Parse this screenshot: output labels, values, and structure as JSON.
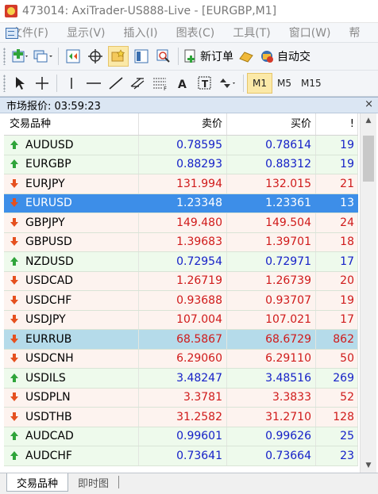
{
  "window": {
    "title": "473014: AxiTrader-US888-Live - [EURGBP,M1]"
  },
  "menu": [
    "文件(F)",
    "显示(V)",
    "插入(I)",
    "图表(C)",
    "工具(T)",
    "窗口(W)",
    "帮"
  ],
  "toolbar": {
    "new_order_label": "新订单",
    "autotrade_label": "自动交"
  },
  "timeframes": [
    "M1",
    "M5",
    "M15"
  ],
  "panel": {
    "title": "市场报价: 03:59:23",
    "close_glyph": "×"
  },
  "columns": {
    "symbol": "交易品种",
    "bid": "卖价",
    "ask": "买价",
    "spread": "!"
  },
  "rows": [
    {
      "symbol": "AUDUSD",
      "bid": "0.78595",
      "ask": "0.78614",
      "spread": "19",
      "dir": "up"
    },
    {
      "symbol": "EURGBP",
      "bid": "0.88293",
      "ask": "0.88312",
      "spread": "19",
      "dir": "up"
    },
    {
      "symbol": "EURJPY",
      "bid": "131.994",
      "ask": "132.015",
      "spread": "21",
      "dir": "down"
    },
    {
      "symbol": "EURUSD",
      "bid": "1.23348",
      "ask": "1.23361",
      "spread": "13",
      "dir": "down"
    },
    {
      "symbol": "GBPJPY",
      "bid": "149.480",
      "ask": "149.504",
      "spread": "24",
      "dir": "down"
    },
    {
      "symbol": "GBPUSD",
      "bid": "1.39683",
      "ask": "1.39701",
      "spread": "18",
      "dir": "down"
    },
    {
      "symbol": "NZDUSD",
      "bid": "0.72954",
      "ask": "0.72971",
      "spread": "17",
      "dir": "up"
    },
    {
      "symbol": "USDCAD",
      "bid": "1.26719",
      "ask": "1.26739",
      "spread": "20",
      "dir": "down"
    },
    {
      "symbol": "USDCHF",
      "bid": "0.93688",
      "ask": "0.93707",
      "spread": "19",
      "dir": "down"
    },
    {
      "symbol": "USDJPY",
      "bid": "107.004",
      "ask": "107.021",
      "spread": "17",
      "dir": "down"
    },
    {
      "symbol": "EURRUB",
      "bid": "68.5867",
      "ask": "68.6729",
      "spread": "862",
      "dir": "down"
    },
    {
      "symbol": "USDCNH",
      "bid": "6.29060",
      "ask": "6.29110",
      "spread": "50",
      "dir": "down"
    },
    {
      "symbol": "USDILS",
      "bid": "3.48247",
      "ask": "3.48516",
      "spread": "269",
      "dir": "up"
    },
    {
      "symbol": "USDPLN",
      "bid": "3.3781",
      "ask": "3.3833",
      "spread": "52",
      "dir": "down"
    },
    {
      "symbol": "USDTHB",
      "bid": "31.2582",
      "ask": "31.2710",
      "spread": "128",
      "dir": "down"
    },
    {
      "symbol": "AUDCAD",
      "bid": "0.99601",
      "ask": "0.99626",
      "spread": "25",
      "dir": "up"
    },
    {
      "symbol": "AUDCHF",
      "bid": "0.73641",
      "ask": "0.73664",
      "spread": "23",
      "dir": "up"
    }
  ],
  "selected_row": "EURUSD",
  "highlighted_row": "EURRUB",
  "bottom_tabs": [
    "交易品种",
    "即时图"
  ],
  "colors": {
    "up": "#2fa43a",
    "down": "#e5501f",
    "selected": "#3d8ee8",
    "highlight": "#b5dbea",
    "bid_up": "#1520c8",
    "bid_down": "#d01a1a"
  }
}
